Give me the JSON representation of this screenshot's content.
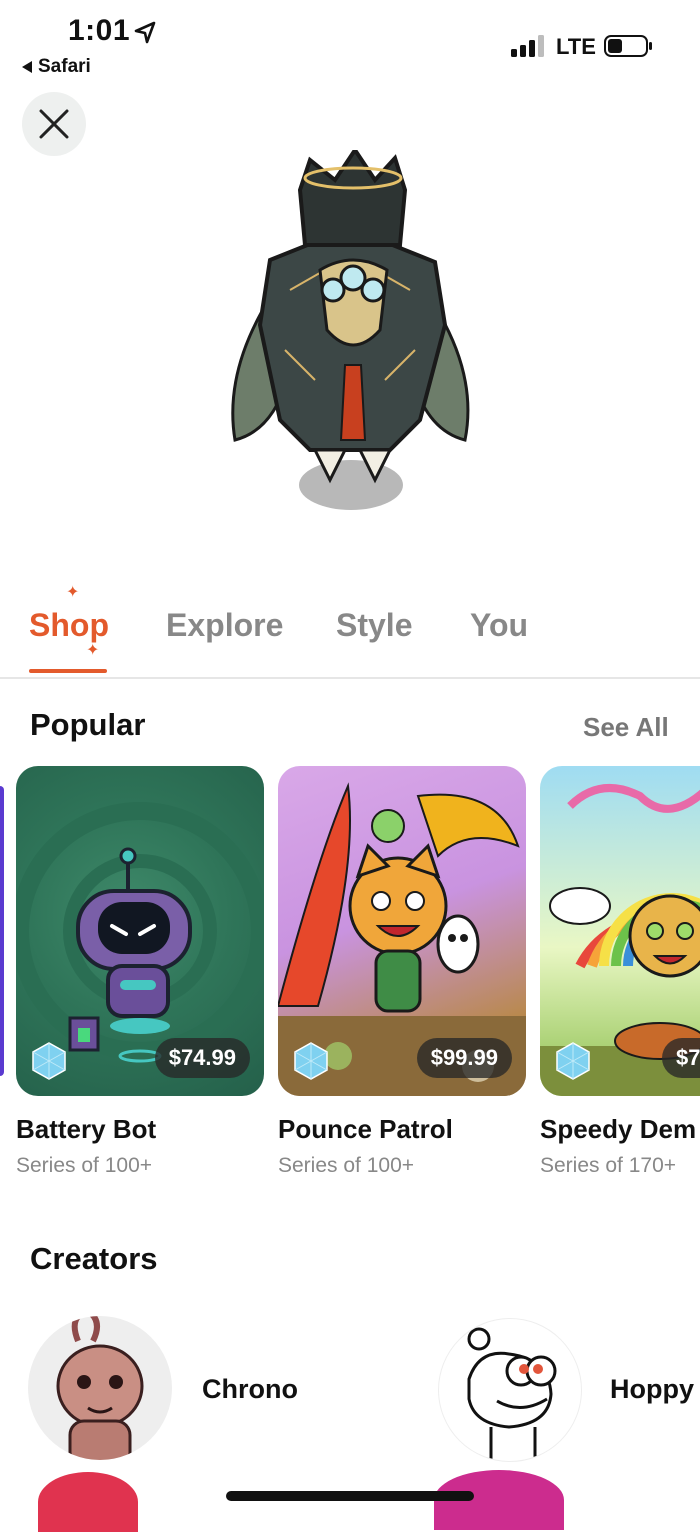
{
  "status_bar": {
    "time": "1:01",
    "back_app": "Safari",
    "network": "LTE"
  },
  "icons": {
    "close": "close-icon",
    "location": "location-arrow-icon",
    "signal": "signal-bars-icon",
    "battery": "battery-icon",
    "gem": "gem-icon"
  },
  "tabs": [
    {
      "label": "Shop",
      "active": true
    },
    {
      "label": "Explore",
      "active": false
    },
    {
      "label": "Style",
      "active": false
    },
    {
      "label": "You",
      "active": false
    }
  ],
  "popular": {
    "title": "Popular",
    "see_all": "See All",
    "cards": [
      {
        "name": "Battery Bot",
        "subtitle": "Series of 100+",
        "price": "$74.99"
      },
      {
        "name": "Pounce Patrol",
        "subtitle": "Series of 100+",
        "price": "$99.99"
      },
      {
        "name": "Speedy Dem",
        "subtitle": "Series of 170+",
        "price": "$7"
      }
    ]
  },
  "creators": {
    "title": "Creators",
    "items": [
      {
        "name": "Chrono"
      },
      {
        "name": "Hoppy"
      }
    ]
  },
  "colors": {
    "accent": "#e35a2c",
    "muted": "#888888"
  }
}
